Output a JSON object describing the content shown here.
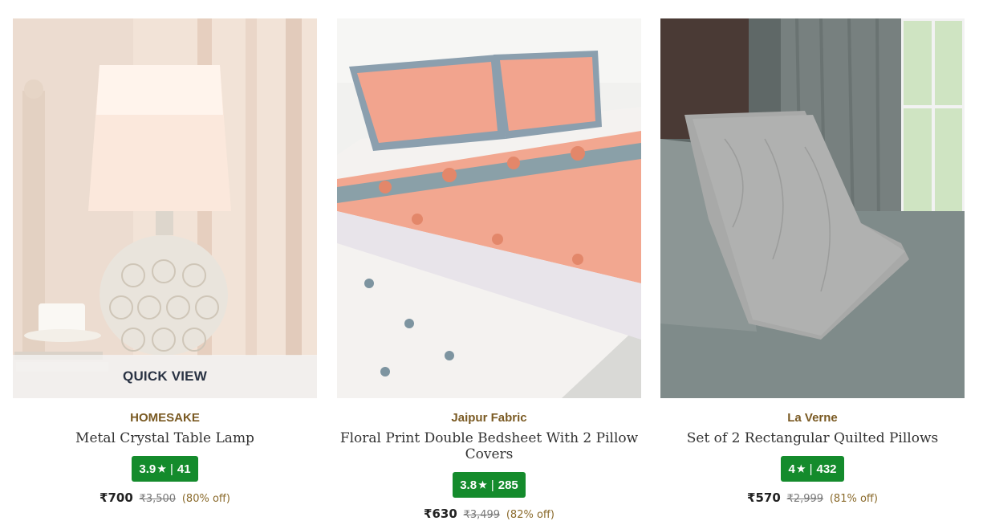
{
  "products": [
    {
      "brand": "HOMESAKE",
      "title": "Metal Crystal Table Lamp",
      "rating": "3.9",
      "reviews": "41",
      "price": "₹700",
      "mrp": "₹3,500",
      "discount": "(80% off)",
      "quick_view": "QUICK VIEW"
    },
    {
      "brand": "Jaipur Fabric",
      "title": "Floral Print Double Bedsheet With 2 Pillow Covers",
      "rating": "3.8",
      "reviews": "285",
      "price": "₹630",
      "mrp": "₹3,499",
      "discount": "(82% off)"
    },
    {
      "brand": "La Verne",
      "title": "Set of 2 Rectangular Quilted Pillows",
      "rating": "4",
      "reviews": "432",
      "price": "₹570",
      "mrp": "₹2,999",
      "discount": "(81% off)"
    }
  ],
  "rating_icon": "star-icon",
  "colors": {
    "brand": "#7a5a23",
    "rating_bg": "#148b2c",
    "discount": "#8a6a2b"
  }
}
